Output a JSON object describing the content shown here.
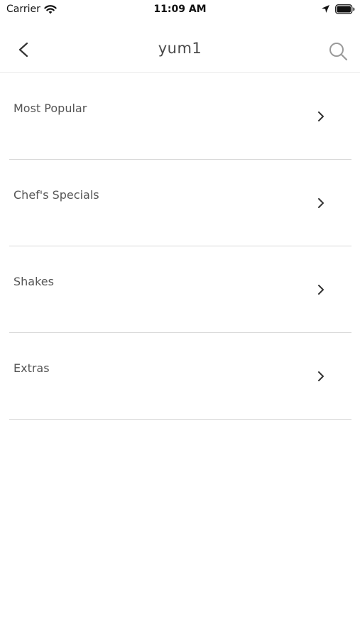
{
  "status_bar": {
    "carrier": "Carrier",
    "time": "11:09 AM",
    "icons": [
      "wifi-icon",
      "location-arrow-icon",
      "battery-icon"
    ]
  },
  "nav": {
    "title": "yum1",
    "back_icon": "chevron-left-icon",
    "search_icon": "search-icon"
  },
  "categories": [
    {
      "label": "Most Popular"
    },
    {
      "label": "Chef's Specials"
    },
    {
      "label": "Shakes"
    },
    {
      "label": "Extras"
    }
  ],
  "colors": {
    "background": "#ffffff",
    "text": "#555555",
    "title": "#4a4a4a",
    "divider": "#d8d8d8"
  }
}
